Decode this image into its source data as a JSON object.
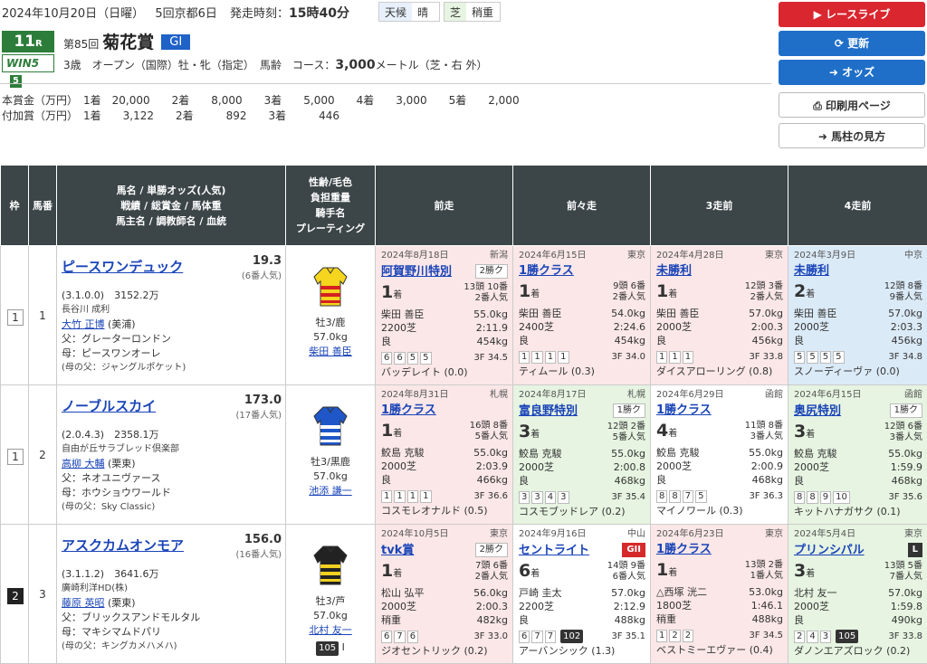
{
  "race": {
    "date": "2024年10月20日（日曜）",
    "meet": "5回京都6日",
    "start_label": "発走時刻：",
    "start_time": "15時40分",
    "weather_label": "天候",
    "weather": "晴",
    "surface_label": "芝",
    "going": "稍重",
    "r_num": "11",
    "r_suffix": "R",
    "win5": "WIN5",
    "win5_num": "5",
    "edition": "第85回",
    "title": "菊花賞",
    "grade": "GI",
    "conditions": "3歳　オープン（国際）牡・牝（指定）　馬齢　コース：",
    "distance": "3,000",
    "dist_unit": "メートル（芝・右 外）",
    "prize1": "本賞金（万円）　1着　20,000　　2着　　8,000　　3着　　5,000　　4着　　3,000　　5着　　2,000",
    "prize2": "付加賞（万円）　1着　　3,122　　2着　　　892　　3着　　　446"
  },
  "side": {
    "live": "レースライブ",
    "refresh": "更新",
    "odds": "オッズ",
    "print": "印刷用ページ",
    "guide": "馬柱の見方",
    "live_color": "#d9262f",
    "blue": "#1f6fc9"
  },
  "table": {
    "headers": [
      "枠",
      "馬番",
      "馬名 / 単勝オッズ(人気)\n戦績 / 総賞金 / 馬体重\n馬主名 / 調教師名 / 血統",
      "性齢/毛色\n負担重量\n騎手名\nプレーティング",
      "前走",
      "前々走",
      "3走前",
      "4走前"
    ]
  },
  "horses": [
    {
      "waku": "1",
      "num": "1",
      "name": "ピースワンデュック",
      "odds": "19.3",
      "pop": "(6番人気)",
      "record": "(3.1.0.0)　3152.2万",
      "owner": "長谷川 成利",
      "trainer": "大竹 正博",
      "stable": "(美浦)",
      "sire": "父：グレーターロンドン",
      "dam": "母：ピースワンオーレ",
      "bms": "(母の父：ジャングルポケット)",
      "sex": "牡3/鹿",
      "wt": "57.0kg",
      "jockey": "柴田 善臣",
      "rating": "",
      "silk": "yellow",
      "past": [
        {
          "bg": "pk",
          "date": "2024年8月18日",
          "track": "新潟",
          "race": "阿賀野川特別",
          "cls": "2勝ク",
          "ct": "",
          "pos": "1",
          "heads": "13頭 10番",
          "pop": "2番人気",
          "jockey": "柴田 善臣",
          "wt": "55.0kg",
          "dist": "2200芝",
          "time": "2:11.9",
          "going": "良",
          "bw": "454kg",
          "pass": [
            "6",
            "6",
            "5",
            "5"
          ],
          "rt": "",
          "f3": "3F 34.5",
          "rival": "バッデレイト (0.0)"
        },
        {
          "bg": "pk",
          "date": "2024年6月15日",
          "track": "東京",
          "race": "1勝クラス",
          "cls": "",
          "ct": "",
          "pos": "1",
          "heads": "9頭 6番",
          "pop": "2番人気",
          "jockey": "柴田 善臣",
          "wt": "54.0kg",
          "dist": "2400芝",
          "time": "2:24.6",
          "going": "良",
          "bw": "454kg",
          "pass": [
            "1",
            "1",
            "1",
            "1"
          ],
          "rt": "",
          "f3": "3F 34.0",
          "rival": "ティムール (0.3)"
        },
        {
          "bg": "pk",
          "date": "2024年4月28日",
          "track": "東京",
          "race": "未勝利",
          "cls": "",
          "ct": "",
          "pos": "1",
          "heads": "12頭 3番",
          "pop": "2番人気",
          "jockey": "柴田 善臣",
          "wt": "57.0kg",
          "dist": "2000芝",
          "time": "2:00.3",
          "going": "良",
          "bw": "456kg",
          "pass": [
            "1",
            "1",
            "1"
          ],
          "rt": "",
          "f3": "3F 33.8",
          "rival": "ダイスアローリング (0.8)"
        },
        {
          "bg": "bl",
          "date": "2024年3月9日",
          "track": "中京",
          "race": "未勝利",
          "cls": "",
          "ct": "",
          "pos": "2",
          "heads": "12頭 8番",
          "pop": "9番人気",
          "jockey": "柴田 善臣",
          "wt": "57.0kg",
          "dist": "2000芝",
          "time": "2:03.3",
          "going": "良",
          "bw": "456kg",
          "pass": [
            "5",
            "5",
            "5",
            "5"
          ],
          "rt": "",
          "f3": "3F 34.8",
          "rival": "スノーディーヴァ (0.0)"
        }
      ]
    },
    {
      "waku": "1",
      "num": "2",
      "name": "ノーブルスカイ",
      "odds": "173.0",
      "pop": "(17番人気)",
      "record": "(2.0.4.3)　2358.1万",
      "owner": "自由が丘サラブレッド倶楽部",
      "trainer": "高柳 大輔",
      "stable": "(栗東)",
      "sire": "父：ネオユニヴァース",
      "dam": "母：ホウショウワールド",
      "bms": "(母の父：Sky Classic)",
      "sex": "牡3/黒鹿",
      "wt": "57.0kg",
      "jockey": "池添 謙一",
      "rating": "",
      "silk": "blue",
      "past": [
        {
          "bg": "pk",
          "date": "2024年8月31日",
          "track": "札幌",
          "race": "1勝クラス",
          "cls": "",
          "ct": "",
          "pos": "1",
          "heads": "16頭 8番",
          "pop": "5番人気",
          "jockey": "鮫島 克駿",
          "wt": "55.0kg",
          "dist": "2000芝",
          "time": "2:03.9",
          "going": "良",
          "bw": "466kg",
          "pass": [
            "1",
            "1",
            "1",
            "1"
          ],
          "rt": "",
          "f3": "3F 36.6",
          "rival": "コスモレオナルド (0.5)"
        },
        {
          "bg": "gr",
          "date": "2024年8月17日",
          "track": "札幌",
          "race": "富良野特別",
          "cls": "1勝ク",
          "ct": "",
          "pos": "3",
          "heads": "12頭 2番",
          "pop": "5番人気",
          "jockey": "鮫島 克駿",
          "wt": "55.0kg",
          "dist": "2000芝",
          "time": "2:00.8",
          "going": "良",
          "bw": "468kg",
          "pass": [
            "3",
            "3",
            "4",
            "3"
          ],
          "rt": "",
          "f3": "3F 35.4",
          "rival": "コスモブッドレア (0.2)"
        },
        {
          "bg": "wh",
          "date": "2024年6月29日",
          "track": "函館",
          "race": "1勝クラス",
          "cls": "",
          "ct": "",
          "pos": "4",
          "heads": "11頭 8番",
          "pop": "3番人気",
          "jockey": "鮫島 克駿",
          "wt": "55.0kg",
          "dist": "2000芝",
          "time": "2:00.9",
          "going": "良",
          "bw": "468kg",
          "pass": [
            "8",
            "8",
            "7",
            "5"
          ],
          "rt": "",
          "f3": "3F 36.3",
          "rival": "マイノワール (0.3)"
        },
        {
          "bg": "gr",
          "date": "2024年6月15日",
          "track": "函館",
          "race": "奥尻特別",
          "cls": "1勝ク",
          "ct": "",
          "pos": "3",
          "heads": "12頭 6番",
          "pop": "3番人気",
          "jockey": "鮫島 克駿",
          "wt": "55.0kg",
          "dist": "2000芝",
          "time": "1:59.9",
          "going": "良",
          "bw": "468kg",
          "pass": [
            "8",
            "8",
            "9",
            "10"
          ],
          "rt": "",
          "f3": "3F 35.6",
          "rival": "キットハナガサク (0.1)"
        }
      ]
    },
    {
      "waku": "2",
      "num": "3",
      "name": "アスクカムオンモア",
      "odds": "156.0",
      "pop": "(16番人気)",
      "record": "(3.1.1.2)　3641.6万",
      "owner": "廣崎利洋HD(株)",
      "trainer": "藤原 英昭",
      "stable": "(栗東)",
      "sire": "父：ブリックスアンドモルタル",
      "dam": "母：マキシマムドパリ",
      "bms": "(母の父：キングカメハメハ)",
      "sex": "牡3/芦",
      "wt": "57.0kg",
      "jockey": "北村 友一",
      "rating": "105",
      "rating_suffix": "I",
      "silk": "black",
      "past": [
        {
          "bg": "pk",
          "date": "2024年10月5日",
          "track": "東京",
          "race": "tvk賞",
          "cls": "2勝ク",
          "ct": "",
          "pos": "1",
          "heads": "7頭 6番",
          "pop": "2番人気",
          "jockey": "松山 弘平",
          "wt": "56.0kg",
          "dist": "2000芝",
          "time": "2:00.3",
          "going": "稍重",
          "bw": "482kg",
          "pass": [
            "6",
            "7",
            "6"
          ],
          "rt": "",
          "f3": "3F 33.0",
          "rival": "ジオセントリック (0.2)"
        },
        {
          "bg": "wh",
          "date": "2024年9月16日",
          "track": "中山",
          "race": "セントライト",
          "cls": "GII",
          "ct": "g2",
          "pos": "6",
          "heads": "14頭 9番",
          "pop": "6番人気",
          "jockey": "戸崎 圭太",
          "wt": "57.0kg",
          "dist": "2200芝",
          "time": "2:12.9",
          "going": "良",
          "bw": "488kg",
          "pass": [
            "6",
            "7",
            "7"
          ],
          "rt": "102",
          "f3": "3F 35.1",
          "rival": "アーバンシック (1.3)"
        },
        {
          "bg": "pk",
          "date": "2024年6月23日",
          "track": "東京",
          "race": "1勝クラス",
          "cls": "",
          "ct": "",
          "pos": "1",
          "heads": "13頭 2番",
          "pop": "1番人気",
          "jockey": "△西塚 洸二",
          "wt": "53.0kg",
          "dist": "1800芝",
          "time": "1:46.1",
          "going": "稍重",
          "bw": "488kg",
          "pass": [
            "1",
            "2",
            "2"
          ],
          "rt": "",
          "f3": "3F 34.5",
          "rival": "ベストミーエヴァー (0.4)"
        },
        {
          "bg": "gr",
          "date": "2024年5月4日",
          "track": "東京",
          "race": "プリンシパル",
          "cls": "L",
          "ct": "l",
          "pos": "3",
          "heads": "13頭 5番",
          "pop": "7番人気",
          "jockey": "北村 友一",
          "wt": "57.0kg",
          "dist": "2000芝",
          "time": "1:59.8",
          "going": "良",
          "bw": "490kg",
          "pass": [
            "2",
            "4",
            "3"
          ],
          "rt": "105",
          "f3": "3F 33.8",
          "rival": "ダノンエアズロック (0.2)"
        }
      ]
    }
  ]
}
